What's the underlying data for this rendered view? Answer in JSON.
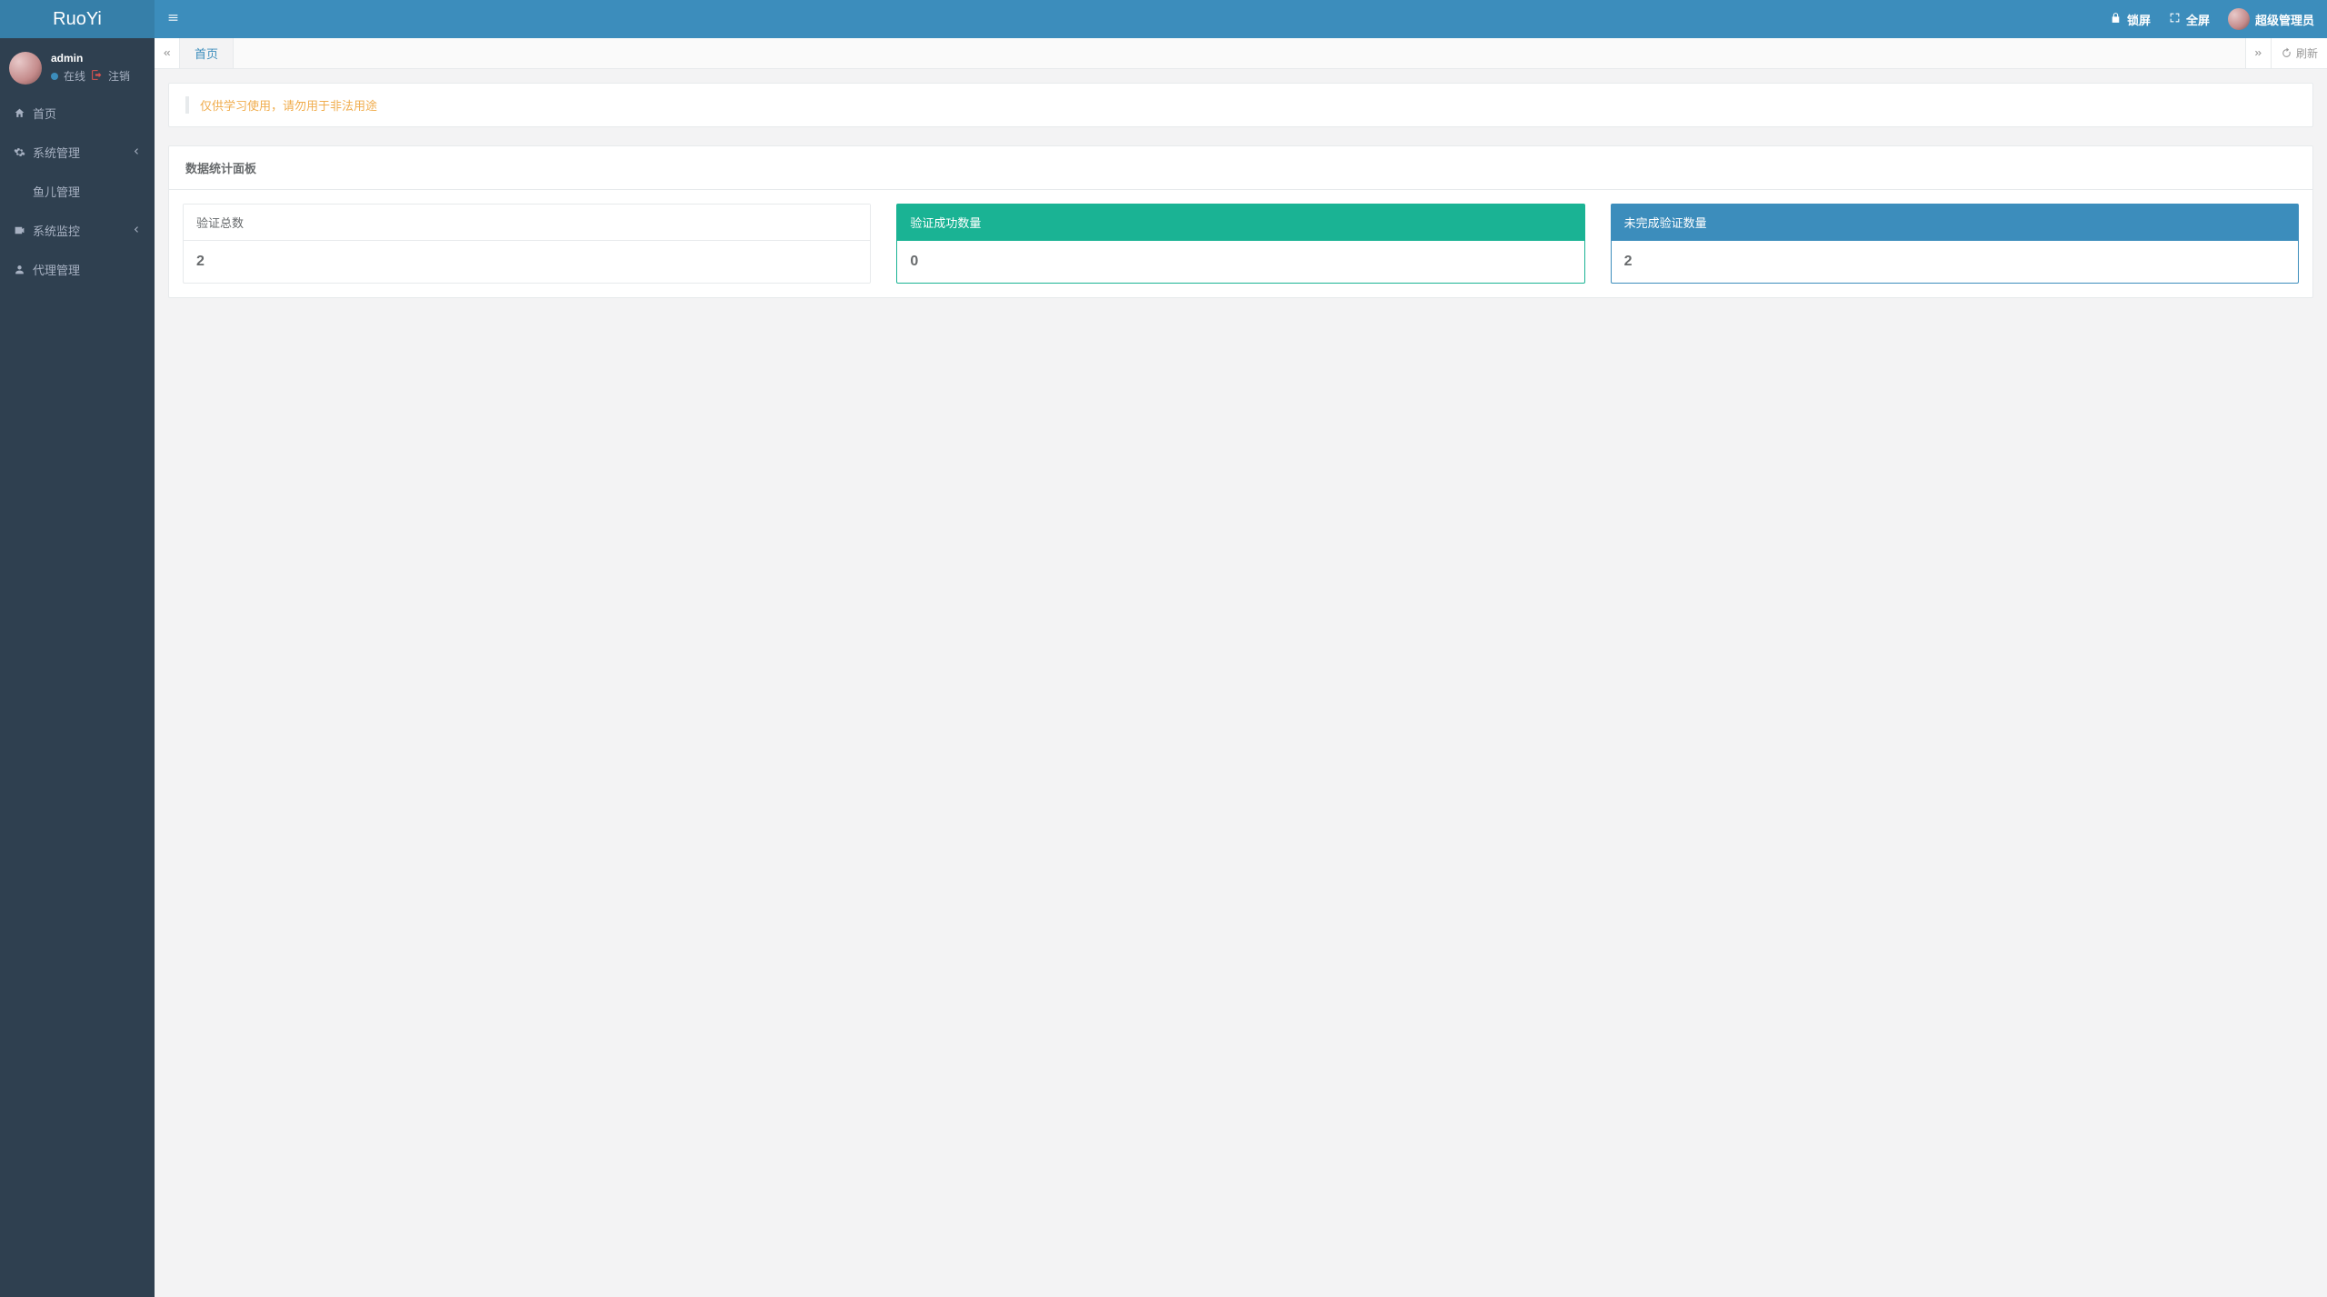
{
  "brand": "RuoYi",
  "user": {
    "name": "admin",
    "status_label": "在线",
    "logout_label": "注销"
  },
  "sidebar": {
    "items": [
      {
        "icon": "home",
        "label": "首页",
        "has_children": false
      },
      {
        "icon": "gear",
        "label": "系统管理",
        "has_children": true
      },
      {
        "icon": "",
        "label": "鱼儿管理",
        "has_children": false
      },
      {
        "icon": "video",
        "label": "系统监控",
        "has_children": true
      },
      {
        "icon": "person",
        "label": "代理管理",
        "has_children": false
      }
    ]
  },
  "topbar": {
    "lock_label": "锁屏",
    "fullscreen_label": "全屏",
    "username_display": "超级管理员"
  },
  "tabs": {
    "active_label": "首页",
    "refresh_label": "刷新"
  },
  "notice": "仅供学习使用，请勿用于非法用途",
  "panel": {
    "title": "数据统计面板",
    "cards": [
      {
        "title": "验证总数",
        "value": "2",
        "theme": "plain"
      },
      {
        "title": "验证成功数量",
        "value": "0",
        "theme": "green"
      },
      {
        "title": "未完成验证数量",
        "value": "2",
        "theme": "blue"
      }
    ]
  }
}
